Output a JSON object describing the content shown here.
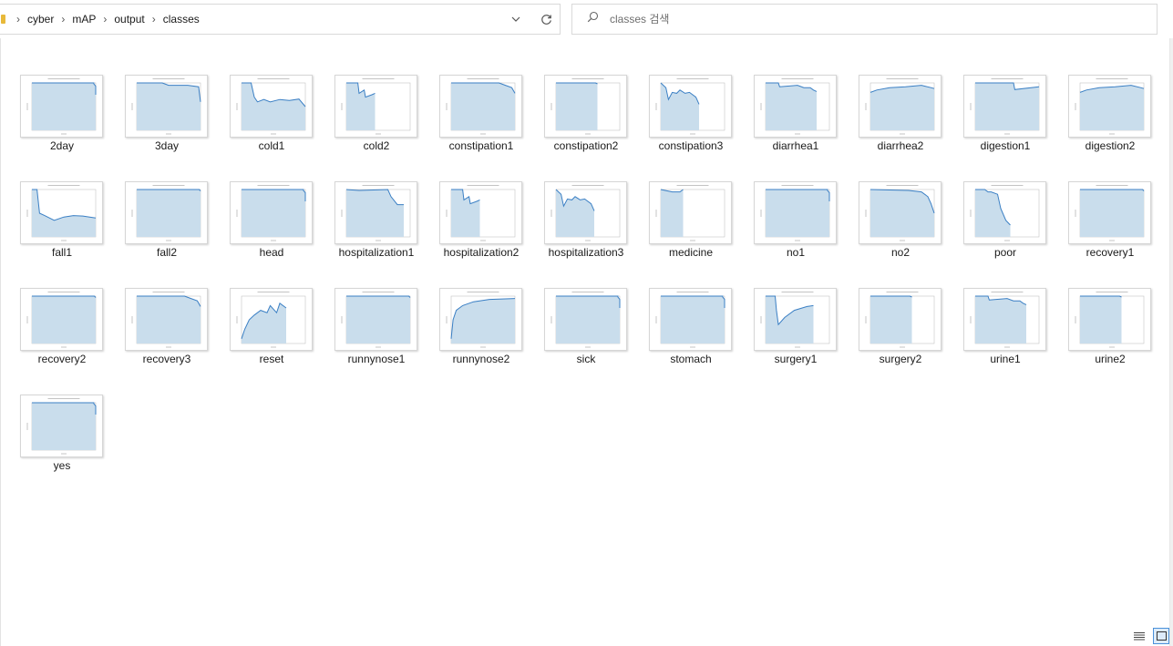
{
  "address_bar": {
    "breadcrumbs": [
      "cyber",
      "mAP",
      "output",
      "classes"
    ],
    "dropdown_icon": "chevron-down-icon",
    "refresh_icon": "refresh-icon"
  },
  "search": {
    "placeholder": "classes 검색",
    "icon": "search-icon"
  },
  "files": [
    {
      "name": "2day",
      "curve": "flat-drop"
    },
    {
      "name": "3day",
      "curve": "flat-slight"
    },
    {
      "name": "cold1",
      "curve": "drop-wavy"
    },
    {
      "name": "cold2",
      "curve": "short-jagged"
    },
    {
      "name": "constipation1",
      "curve": "flat-tail"
    },
    {
      "name": "constipation2",
      "curve": "flat-short"
    },
    {
      "name": "constipation3",
      "curve": "jagged-mid"
    },
    {
      "name": "diarrhea1",
      "curve": "flat-steps"
    },
    {
      "name": "diarrhea2",
      "curve": "rise-flat"
    },
    {
      "name": "digestion1",
      "curve": "flat-step-down"
    },
    {
      "name": "digestion2",
      "curve": "rise-flat"
    },
    {
      "name": "fall1",
      "curve": "drop-wavy-long"
    },
    {
      "name": "fall2",
      "curve": "flat-full"
    },
    {
      "name": "head",
      "curve": "flat-drop"
    },
    {
      "name": "hospitalization1",
      "curve": "flat-drop-mid"
    },
    {
      "name": "hospitalization2",
      "curve": "short-jagged"
    },
    {
      "name": "hospitalization3",
      "curve": "jagged-mid"
    },
    {
      "name": "medicine",
      "curve": "tiny"
    },
    {
      "name": "no1",
      "curve": "flat-drop"
    },
    {
      "name": "no2",
      "curve": "flat-decline"
    },
    {
      "name": "poor",
      "curve": "steep-decline"
    },
    {
      "name": "recovery1",
      "curve": "flat-full"
    },
    {
      "name": "recovery2",
      "curve": "flat-full"
    },
    {
      "name": "recovery3",
      "curve": "flat-tail"
    },
    {
      "name": "reset",
      "curve": "rise-jagged"
    },
    {
      "name": "runnynose1",
      "curve": "flat-full"
    },
    {
      "name": "runnynose2",
      "curve": "log-rise"
    },
    {
      "name": "sick",
      "curve": "flat-drop"
    },
    {
      "name": "stomach",
      "curve": "flat-drop"
    },
    {
      "name": "surgery1",
      "curve": "drop-recover"
    },
    {
      "name": "surgery2",
      "curve": "flat-short"
    },
    {
      "name": "urine1",
      "curve": "flat-steps"
    },
    {
      "name": "urine2",
      "curve": "flat-short"
    },
    {
      "name": "yes",
      "curve": "flat-drop"
    }
  ],
  "view_toggles": {
    "details_icon": "details-view-icon",
    "large_icons_icon": "large-icons-view-icon",
    "active": "large-icons"
  },
  "colors": {
    "fill": "#c9ddec",
    "line": "#3a7fc4",
    "border": "#d9d9d9",
    "accent": "#4a90d9"
  }
}
